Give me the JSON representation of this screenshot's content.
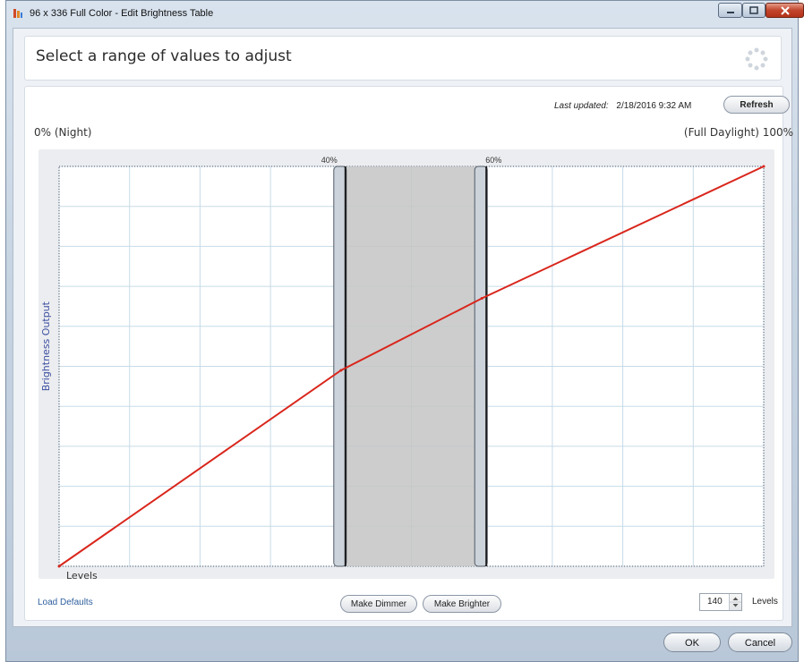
{
  "window": {
    "title": "96 x 336 Full Color - Edit Brightness Table",
    "controls": {
      "minimize": "minimize",
      "maximize": "maximize",
      "close": "close"
    }
  },
  "header": {
    "title": "Select a range of values to adjust"
  },
  "status": {
    "last_updated_label": "Last updated:",
    "last_updated_value": "2/18/2016 9:32 AM",
    "refresh_label": "Refresh"
  },
  "range_labels": {
    "left": "0% (Night)",
    "right": "(Full Daylight) 100%"
  },
  "chart_data": {
    "type": "line",
    "ylabel": "Brightness Output",
    "xlabel": "Levels",
    "x_range": [
      0,
      100
    ],
    "y_range": [
      0,
      100
    ],
    "grid": true,
    "series": [
      {
        "color": "#d9261c",
        "points": [
          [
            0,
            0
          ],
          [
            40,
            49
          ],
          [
            60,
            67
          ],
          [
            100,
            100
          ]
        ]
      }
    ],
    "selection": {
      "start_label": "40%",
      "end_label": "60%",
      "start": 40,
      "end": 60
    }
  },
  "actions": {
    "load_defaults": "Load Defaults",
    "make_dimmer": "Make Dimmer",
    "make_brighter": "Make Brighter",
    "levels_value": "140",
    "levels_label": "Levels"
  },
  "dialog": {
    "ok": "OK",
    "cancel": "Cancel"
  },
  "icons": {
    "app": "app-icon",
    "busy": "spinner-icon",
    "spin_up": "spin-up-icon",
    "spin_down": "spin-down-icon"
  }
}
